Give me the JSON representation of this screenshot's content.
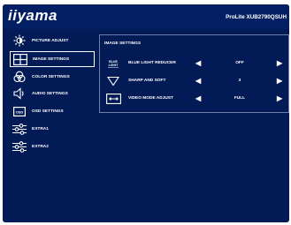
{
  "header": {
    "logo": "iiyama",
    "model": "ProLite XUB2790QSUH"
  },
  "sidebar": {
    "items": [
      {
        "label": "PICTURE ADJUST"
      },
      {
        "label": "IMAGE SETTINGS"
      },
      {
        "label": "COLOR SETTINGS"
      },
      {
        "label": "AUDIO SETTINGS"
      },
      {
        "label": "OSD SETTINGS"
      },
      {
        "label": "EXTRA1"
      },
      {
        "label": "EXTRA2"
      }
    ],
    "osd_icon_text": "OSD"
  },
  "panel": {
    "title": "IMAGE SETTINGS",
    "rows": [
      {
        "label": "BLUE LIGHT REDUCER",
        "value": "OFF",
        "icon_text_1": "BLUE",
        "icon_text_2": "LIGHT"
      },
      {
        "label": "SHARP AND SOFT",
        "value": "3"
      },
      {
        "label": "VIDEO MODE ADJUST",
        "value": "FULL"
      }
    ]
  },
  "arrows": {
    "left": "◀",
    "right": "▶"
  },
  "colors": {
    "background": "#021a55",
    "header": "#021f63",
    "text": "#ffffff"
  }
}
